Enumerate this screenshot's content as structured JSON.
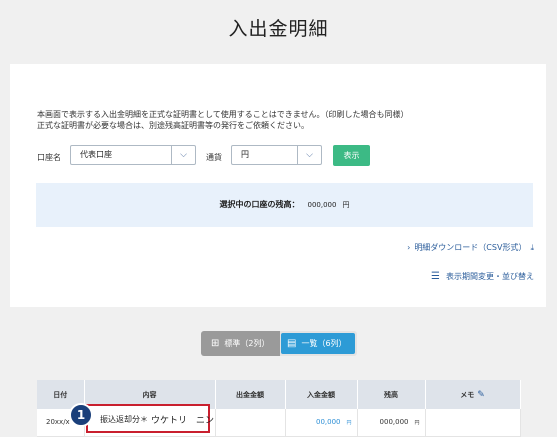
{
  "page": {
    "title": "入出金明細"
  },
  "notice": {
    "line1": "本画面で表示する入出金明細を正式な証明書として使用することはできません。（印刷した場合も同様）",
    "line2": "正式な証明書が必要な場合は、別途残高証明書等の発行をご依頼ください。"
  },
  "filters": {
    "account_label": "口座名",
    "account_value": "代表口座",
    "currency_label": "通貨",
    "currency_value": "円",
    "show_button": "表示",
    "chevron_glyph": "⌵"
  },
  "balance": {
    "label": "選択中の口座の残高：",
    "value": "000,000",
    "unit": "円"
  },
  "links": {
    "csv_download": "明細ダウンロード（CSV形式）",
    "change_period": "表示期間変更・並び替え",
    "arrow_glyph": "›",
    "download_glyph": "⤓",
    "search_list_glyph": "☰"
  },
  "view_toggle": {
    "standard": "標準（2列）",
    "list": "一覧（6列）",
    "grid_glyph": "⊞",
    "list_glyph": "▤"
  },
  "table": {
    "headers": [
      "日付",
      "内容",
      "出金金額",
      "入金金額",
      "残高",
      "メモ"
    ],
    "memo_edit_glyph": "✎",
    "row1": {
      "date": "20xx/x",
      "deposit": "00,000",
      "deposit_unit": "円",
      "balance": "000,000",
      "balance_unit": "円"
    }
  },
  "highlight": {
    "badge": "1",
    "content_label": "振込返却分＊",
    "content_name": "ウケトリ　ニン"
  }
}
